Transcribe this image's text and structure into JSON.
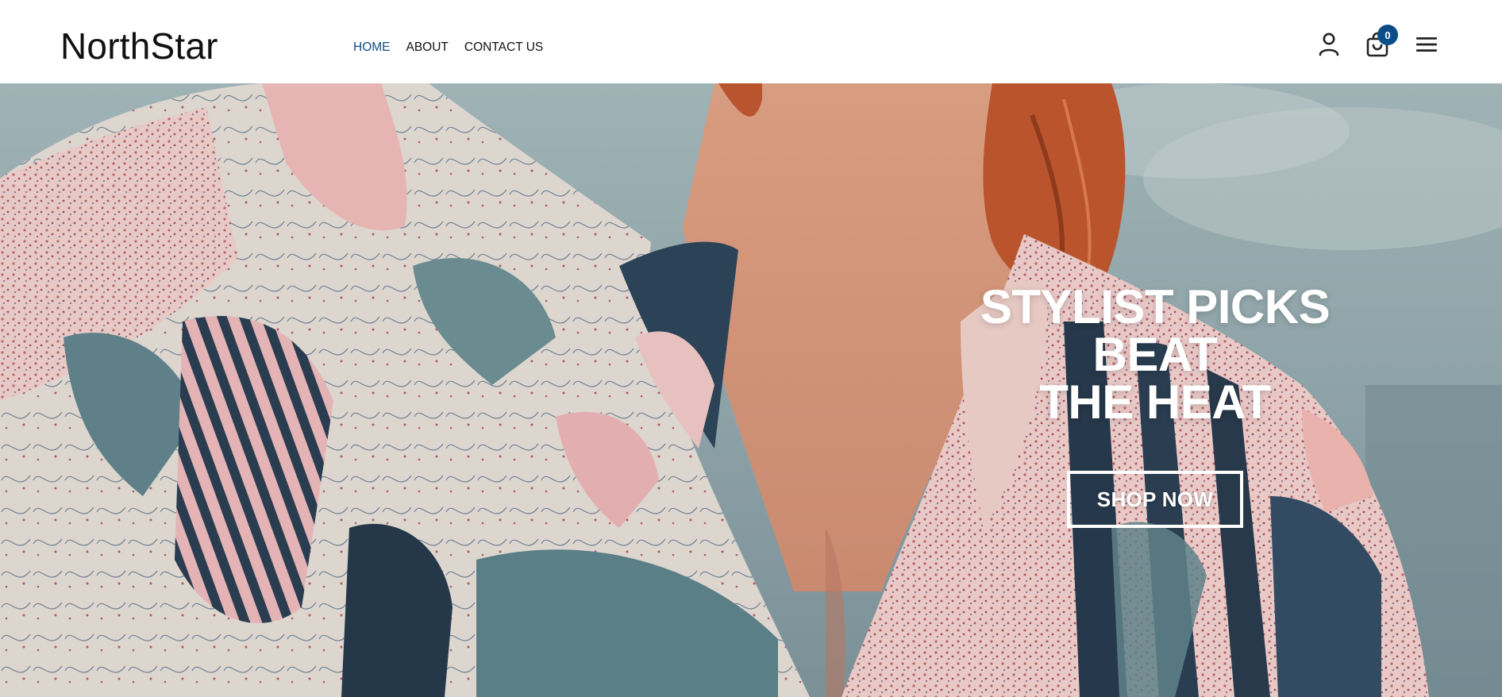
{
  "brand": {
    "name": "NorthStar",
    "accent_color": "#0b4d87"
  },
  "nav": {
    "items": [
      {
        "label": "HOME",
        "active": true
      },
      {
        "label": "ABOUT",
        "active": false
      },
      {
        "label": "CONTACT US",
        "active": false
      }
    ]
  },
  "header_icons": {
    "account_icon": "user-icon",
    "cart_icon": "shopping-bag-icon",
    "cart_count": "0",
    "menu_icon": "hamburger-menu-icon"
  },
  "hero": {
    "title_line1": "STYLIST PICKS BEAT",
    "title_line2": "THE HEAT",
    "cta_label": "SHOP NOW",
    "image_subject": "woman in patterned pink and teal shirt"
  }
}
